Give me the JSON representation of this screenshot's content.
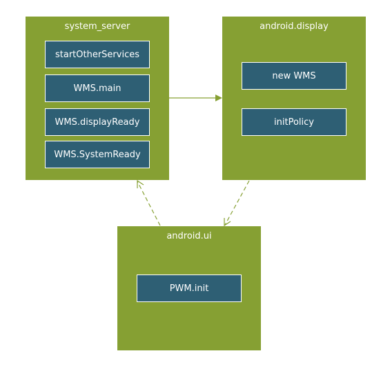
{
  "colors": {
    "group": "#86a033",
    "node": "#2e5f74",
    "arrow": "#86a033"
  },
  "groups": [
    {
      "title": "system_server",
      "nodes": [
        "startOtherServices",
        "WMS.main",
        "WMS.displayReady",
        "WMS.SystemReady"
      ]
    },
    {
      "title": "android.display",
      "nodes": [
        "new WMS",
        "initPolicy"
      ]
    },
    {
      "title": "android.ui",
      "nodes": [
        "PWM.init"
      ]
    }
  ],
  "edges": [
    {
      "from": "system_server",
      "to": "android.display",
      "style": "solid"
    },
    {
      "from": "android.display",
      "to": "android.ui",
      "style": "dashed"
    },
    {
      "from": "android.ui",
      "to": "system_server",
      "style": "dashed"
    }
  ]
}
